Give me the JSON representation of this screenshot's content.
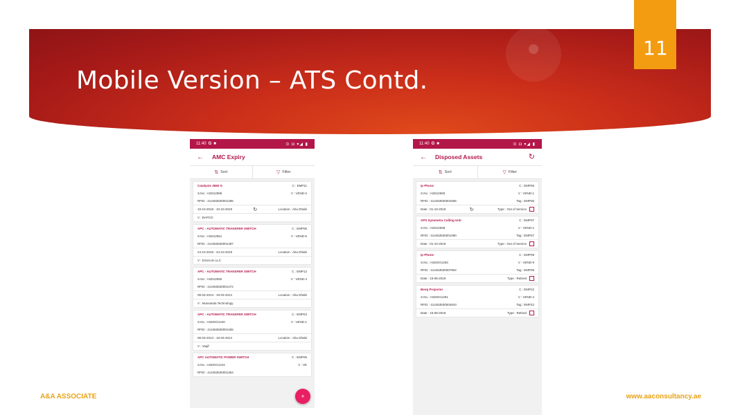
{
  "slide": {
    "title": "Mobile Version – ATS Contd.",
    "page_number": "11",
    "footer_left": "A&A ASSOCIATE",
    "footer_right": "www.aaconsultancy.ae"
  },
  "phone1": {
    "status": {
      "time": "11:40",
      "g": "G",
      "icons": "⊙ ◘ ▾◢ ▮"
    },
    "title": "AMC Expiry",
    "sort": "Sort",
    "filter": "Filter",
    "cards": [
      {
        "name": "Catalysts 3560 G",
        "code": "C : EMP11",
        "sno": "S.No : ASD12586",
        "vend": "V : VEND-2",
        "rfid": "RFID : 414453530001285",
        "dates": "10-10-2019 - 10-10-2019",
        "location": "Location : Abu Dhabi",
        "vendor": "V : BAPCO"
      },
      {
        "name": "APC - AUTOMATIC TRANSFER SWITCH",
        "code": "C : EMP06",
        "sno": "S.No : ASD12551",
        "vend": "V : VEND-6",
        "rfid": "RFID : 414453530001487",
        "dates": "24-10-2018 - 24-10-2019",
        "location": "Location : Abu Dhabi",
        "vendor": "V : Emircom LLC"
      },
      {
        "name": "APC - AUTOMATIC TRANSFER SWITCH",
        "code": "C : EMP12",
        "sno": "S.No : ASD12550",
        "vend": "V : VEND-4",
        "rfid": "RFID : 414453530001472",
        "dates": "06-03-2013 - 19-03-2014",
        "location": "Location : Abu Dhabi",
        "vendor": "V : Mussanda Technology"
      },
      {
        "name": "APC - AUTOMATIC TRANSFER SWITCH",
        "code": "C : EMP04",
        "sno": "S.No : ASDGG1240",
        "vend": "V : VEND-1",
        "rfid": "RFID : 414453530001455",
        "dates": "06-03-2013 - 16-03-2014",
        "location": "Location : Abu Dhabi",
        "vendor": "V : Vaqif"
      },
      {
        "name": "APC AUTOMATIC POWER SWITCH",
        "code": "C : EMP05",
        "sno": "S.No : ASDGG1244",
        "vend": "V : VE",
        "rfid": "RFID : 414453530001354"
      }
    ],
    "fab": "+"
  },
  "phone2": {
    "status": {
      "time": "11:40",
      "g": "G",
      "icons": "⊙ ◘ ▾◢ ▮"
    },
    "title": "Disposed Assets",
    "sort": "Sort",
    "filter": "Filter",
    "cards": [
      {
        "name": "Ip Phone",
        "code": "C : EMP06",
        "sno": "S.No : ASD12560",
        "vend": "V : VEND-1",
        "rfid": "RFID : 414453530001656",
        "tag": "Tag : EMP06",
        "date": "Date : 01-10-2019",
        "type": "Type : Out of Service"
      },
      {
        "name": "APS Symmetra Colling Unit",
        "code": "C : EMP07",
        "sno": "S.No : ASD12558",
        "vend": "V : VEND-1",
        "rfid": "RFID : 414453530001080",
        "tag": "Tag : EMP07",
        "date": "Date : 01-10-2019",
        "type": "Type : Out of Service"
      },
      {
        "name": "Ip Phone",
        "code": "C : EMP09",
        "sno": "S.No : ASDGG1253",
        "vend": "V : VEND-9",
        "rfid": "RFID : 414453530007904",
        "tag": "Tag : EMP09",
        "date": "Date : 15-08-2019",
        "type": "Type : Retired"
      },
      {
        "name": "Benq Projector",
        "code": "C : EMP22",
        "sno": "S.No : ASDGG1251",
        "vend": "V : VEND-4",
        "rfid": "RFID : 414453530004910",
        "tag": "Tag : EMP22",
        "date": "Date : 15-08-2019",
        "type": "Type : Retired"
      }
    ]
  }
}
